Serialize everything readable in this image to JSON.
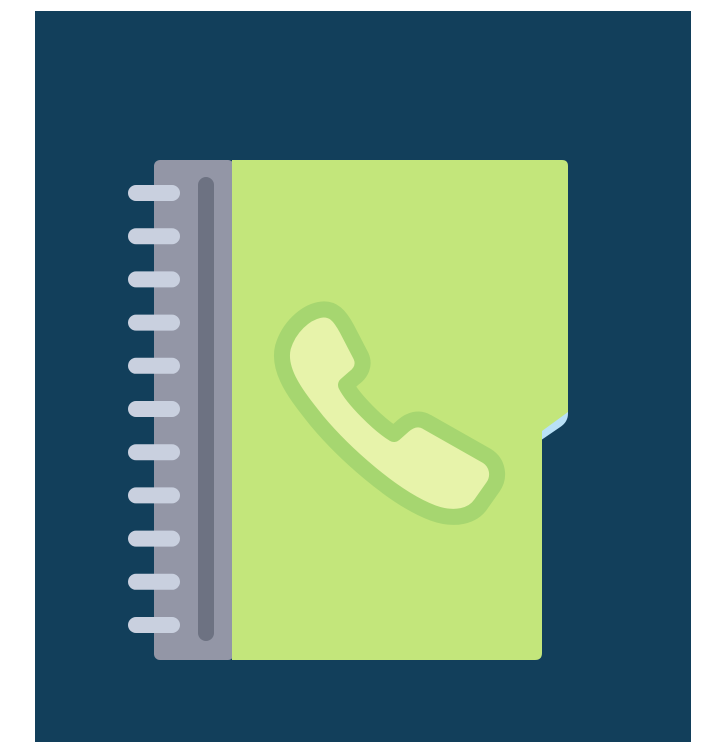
{
  "icon": {
    "name": "address-book-icon",
    "colors": {
      "background": "#123f5b",
      "cover": "#c3e67b",
      "spine": "#9396a6",
      "spine_groove": "#6d7282",
      "rings": "#c9d0df",
      "handset_outline": "#a6d670",
      "handset_fill": "#e7f3aa",
      "tabs": [
        "#ff6262",
        "#ffa154",
        "#ffe16a",
        "#a6d670",
        "#b9e1f7"
      ]
    }
  }
}
